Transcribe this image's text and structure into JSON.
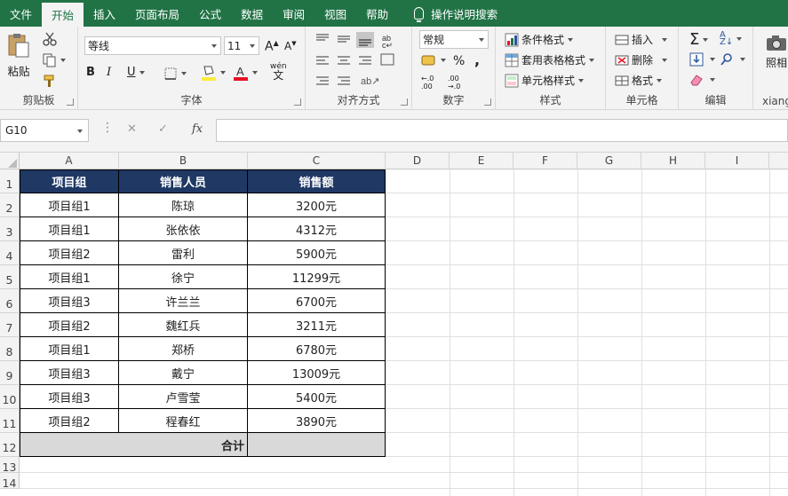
{
  "tabs": [
    "文件",
    "开始",
    "插入",
    "页面布局",
    "公式",
    "数据",
    "审阅",
    "视图",
    "帮助"
  ],
  "active_tab": "开始",
  "tell_me": "操作说明搜索",
  "ribbon": {
    "clipboard": {
      "paste": "粘贴",
      "label": "剪贴板"
    },
    "font": {
      "name": "等线",
      "size": "11",
      "label": "字体",
      "bold": "B",
      "italic": "I",
      "underline": "U",
      "wen": "wén"
    },
    "align": {
      "label": "对齐方式"
    },
    "number": {
      "format": "常规",
      "percent": "%",
      "comma": ",",
      "label": "数字"
    },
    "styles": {
      "cond": "条件格式",
      "table": "套用表格格式",
      "cell": "单元格样式",
      "label": "样式"
    },
    "cells": {
      "insert": "插入",
      "delete": "删除",
      "format": "格式",
      "label": "单元格"
    },
    "editing": {
      "label": "编辑"
    },
    "xiang": {
      "btn": "照相",
      "label": "xiang"
    }
  },
  "namebox": "G10",
  "fx": "fx",
  "columns": [
    "A",
    "B",
    "C",
    "D",
    "E",
    "F",
    "G",
    "H",
    "I"
  ],
  "rows": [
    "1",
    "2",
    "3",
    "4",
    "5",
    "6",
    "7",
    "8",
    "9",
    "10",
    "11",
    "12",
    "13",
    "14"
  ],
  "table": {
    "headers": [
      "项目组",
      "销售人员",
      "销售额"
    ],
    "rows": [
      [
        "项目组1",
        "陈琼",
        "3200元"
      ],
      [
        "项目组1",
        "张依依",
        "4312元"
      ],
      [
        "项目组2",
        "雷利",
        "5900元"
      ],
      [
        "项目组1",
        "徐宁",
        "11299元"
      ],
      [
        "项目组3",
        "许兰兰",
        "6700元"
      ],
      [
        "项目组2",
        "魏红兵",
        "3211元"
      ],
      [
        "项目组1",
        "郑桥",
        "6780元"
      ],
      [
        "项目组3",
        "戴宁",
        "13009元"
      ],
      [
        "项目组3",
        "卢雪莹",
        "5400元"
      ],
      [
        "项目组2",
        "程春红",
        "3890元"
      ]
    ],
    "total_label": "合计"
  },
  "colors": {
    "accent": "#217346",
    "header": "#1f3864",
    "total": "#d9d9d9",
    "font_red": "#e81123",
    "fill_yellow": "#ffeb3b"
  }
}
